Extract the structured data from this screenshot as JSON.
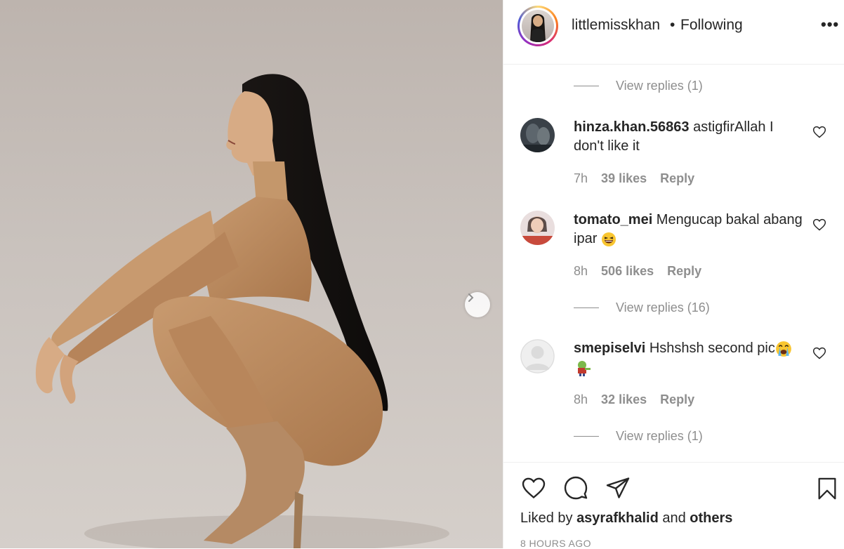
{
  "post": {
    "username": "littlemisskhan",
    "dot": "•",
    "following_label": "Following",
    "more_label": "•••"
  },
  "comments": [
    {
      "type": "view_replies",
      "label": "View replies (1)"
    },
    {
      "type": "comment",
      "user": "hinza.khan.56863",
      "text": " astigfirAllah I don't like it",
      "time": "7h",
      "likes": "39 likes",
      "reply": "Reply"
    },
    {
      "type": "comment",
      "user": "tomato_mei",
      "text": " Mengucap bakal abang ipar",
      "time": "8h",
      "likes": "506 likes",
      "reply": "Reply"
    },
    {
      "type": "view_replies",
      "label": "View replies (16)"
    },
    {
      "type": "comment",
      "user": "smepiselvi",
      "text": " Hshshsh second pic",
      "time": "8h",
      "likes": "32 likes",
      "reply": "Reply"
    },
    {
      "type": "view_replies",
      "label": "View replies (1)"
    }
  ],
  "footer": {
    "liked_prefix": "Liked by ",
    "liked_user": "asyrafkhalid",
    "liked_mid": " and ",
    "liked_others": "others",
    "timestamp": "8 HOURS AGO"
  },
  "icons": {
    "like": "heart-icon",
    "comment": "comment-icon",
    "share": "share-icon",
    "save": "bookmark-icon",
    "next": "chevron-right-icon"
  },
  "colors": {
    "text": "#262626",
    "muted": "#8e8e8e",
    "border": "#efefef"
  }
}
